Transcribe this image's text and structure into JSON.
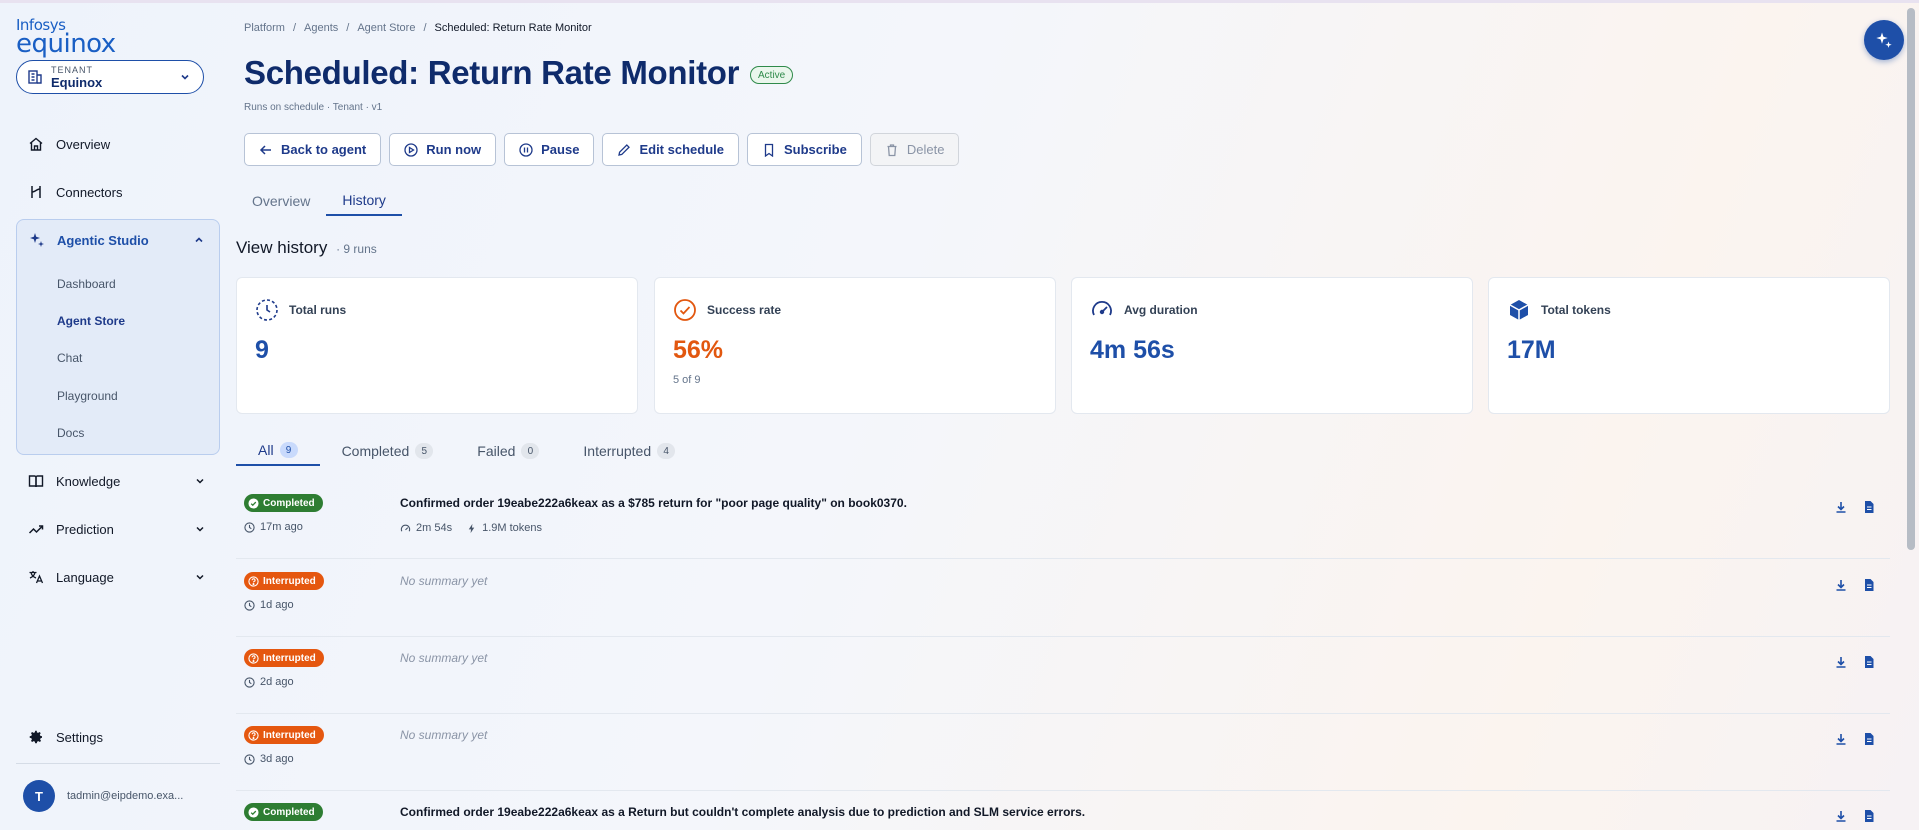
{
  "brand": {
    "line1": "Infosys",
    "line2": "equinox"
  },
  "tenant": {
    "label": "TENANT",
    "value": "Equinox"
  },
  "nav": {
    "overview": "Overview",
    "connectors": "Connectors",
    "studio": {
      "label": "Agentic Studio",
      "items": [
        "Dashboard",
        "Agent Store",
        "Chat",
        "Playground",
        "Docs"
      ]
    },
    "knowledge": "Knowledge",
    "prediction": "Prediction",
    "language": "Language",
    "settings": "Settings"
  },
  "user": {
    "initial": "T",
    "email": "tadmin@eipdemo.exa..."
  },
  "breadcrumb": [
    "Platform",
    "/",
    "Agents",
    "/",
    "Agent Store",
    "/",
    "Scheduled: Return Rate Monitor"
  ],
  "page": {
    "title": "Scheduled: Return Rate Monitor",
    "status": "Active",
    "subtitle": "Runs on schedule · Tenant · v1"
  },
  "toolbar": {
    "back": "Back to agent",
    "run": "Run now",
    "pause": "Pause",
    "edit": "Edit schedule",
    "subscribe": "Subscribe",
    "delete": "Delete"
  },
  "tabs": {
    "overview": "Overview",
    "history": "History"
  },
  "history": {
    "title": "View history",
    "runs": "· 9 runs"
  },
  "stats": {
    "total_runs": {
      "label": "Total runs",
      "value": "9"
    },
    "success_rate": {
      "label": "Success rate",
      "value": "56%",
      "sub": "5 of 9"
    },
    "avg_duration": {
      "label": "Avg duration",
      "value": "4m 56s"
    },
    "total_tokens": {
      "label": "Total tokens",
      "value": "17M"
    }
  },
  "filters": {
    "all": {
      "label": "All",
      "count": "9"
    },
    "completed": {
      "label": "Completed",
      "count": "5"
    },
    "failed": {
      "label": "Failed",
      "count": "0"
    },
    "interrupted": {
      "label": "Interrupted",
      "count": "4"
    }
  },
  "runs": [
    {
      "status": "Completed",
      "time": "17m ago",
      "summary": "Confirmed order 19eabe222a6keax as a $785 return for \"poor page quality\" on book0370.",
      "duration": "2m 54s",
      "tokens": "1.9M tokens"
    },
    {
      "status": "Interrupted",
      "time": "1d ago",
      "summary": "No summary yet"
    },
    {
      "status": "Interrupted",
      "time": "2d ago",
      "summary": "No summary yet"
    },
    {
      "status": "Interrupted",
      "time": "3d ago",
      "summary": "No summary yet"
    },
    {
      "status": "Completed",
      "summary": "Confirmed order 19eabe222a6keax as a Return but couldn't complete analysis due to prediction and SLM service errors."
    }
  ],
  "colors": {
    "primary": "#1e4fa8",
    "completed": "#2e7d32",
    "interrupted": "#e5570f",
    "accent_orange": "#e2570f"
  }
}
